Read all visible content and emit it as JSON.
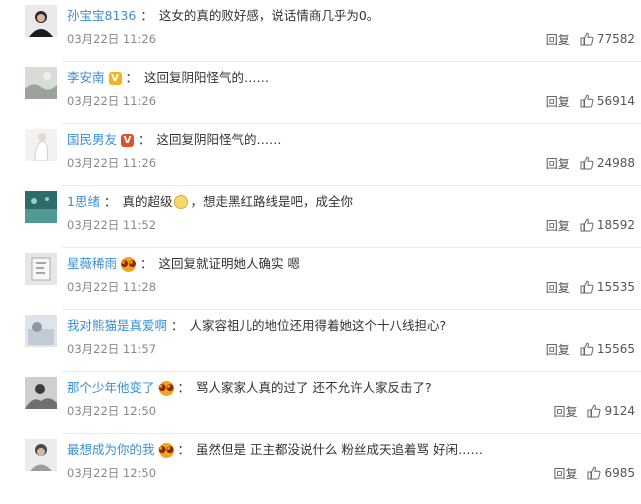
{
  "comments": [
    {
      "username": "孙宝宝8136",
      "badge": "",
      "text": "这女的真的败好感，说话情商几乎为0。",
      "time": "03月22日 11:26",
      "reply": "回复",
      "likes": "77582"
    },
    {
      "username": "李安南",
      "badge": "V",
      "text": "这回复阴阳怪气的……",
      "time": "03月22日 11:26",
      "reply": "回复",
      "likes": "56914"
    },
    {
      "username": "国民男友",
      "badge": "V",
      "text": "这回复阴阳怪气的……",
      "time": "03月22日 11:26",
      "reply": "回复",
      "likes": "24988"
    },
    {
      "username": "1思绪",
      "badge": "",
      "text_before": "真的超级",
      "text_after": "，想走黑红路线是吧，成全你",
      "time": "03月22日 11:52",
      "reply": "回复",
      "likes": "18592"
    },
    {
      "username": "星薇稀雨",
      "badge": "face",
      "text": "这回复就证明她人确实 嗯",
      "time": "03月22日 11:28",
      "reply": "回复",
      "likes": "15535"
    },
    {
      "username": "我对熊猫是真爱啊",
      "badge": "",
      "text": "人家容祖儿的地位还用得着她这个十八线担心?",
      "time": "03月22日 11:57",
      "reply": "回复",
      "likes": "15565"
    },
    {
      "username": "那个少年他变了",
      "badge": "face",
      "text": "骂人家家人真的过了 还不允许人家反击了?",
      "time": "03月22日 12:50",
      "reply": "回复",
      "likes": "9124"
    },
    {
      "username": "最想成为你的我",
      "badge": "face",
      "text": "虽然但是 正主都没说什么 粉丝成天追着骂 好闲……",
      "time": "03月22日 12:50",
      "reply": "回复",
      "likes": "6985"
    }
  ],
  "colors": {
    "username": "#3a8fd6",
    "text": "#333333",
    "meta": "#888888",
    "divider": "#ebebeb",
    "badge_gold": "#f6b31b",
    "badge_red": "#e0502d",
    "face_badge": "#f3a21f"
  },
  "icons": {
    "like": "thumbs-up-icon",
    "verified": "verified-v-icon",
    "member": "member-face-icon",
    "emoji": "smile-emoji-icon"
  }
}
